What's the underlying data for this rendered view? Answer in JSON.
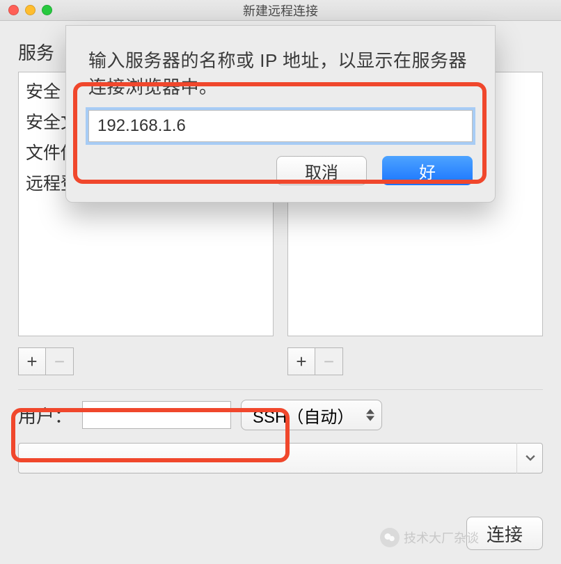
{
  "titlebar": {
    "title": "新建远程连接"
  },
  "sections": {
    "service_label": "服务"
  },
  "service_list": {
    "items": [
      "安全 Shell (ssh)",
      "安全文件传输 (sftp)",
      "文件传输 (ftp)",
      "远程登录 (rlogin)"
    ]
  },
  "addremove": {
    "add": "+",
    "remove": "−"
  },
  "user": {
    "label": "用户：",
    "value": ""
  },
  "protocol_select": {
    "label": "SSH（自动）"
  },
  "address_select": {
    "value": ""
  },
  "connect_button": {
    "label": "连接"
  },
  "dialog": {
    "message": "输入服务器的名称或 IP 地址，以显示在服务器连接浏览器中。",
    "input_value": "192.168.1.6",
    "cancel": "取消",
    "ok": "好"
  },
  "watermark": {
    "text": "技术大厂杂谈"
  }
}
